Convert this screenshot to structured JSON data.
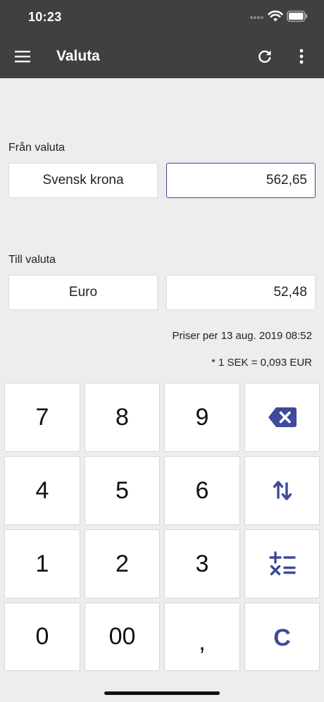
{
  "status_bar": {
    "time": "10:23"
  },
  "app_bar": {
    "title": "Valuta"
  },
  "from": {
    "label": "Från valuta",
    "currency": "Svensk krona",
    "amount": "562,65"
  },
  "to": {
    "label": "Till valuta",
    "currency": "Euro",
    "amount": "52,48"
  },
  "info": {
    "prices": "Priser per 13 aug. 2019 08:52",
    "rate": "* 1 SEK = 0,093 EUR"
  },
  "keypad": {
    "k7": "7",
    "k8": "8",
    "k9": "9",
    "k4": "4",
    "k5": "5",
    "k6": "6",
    "k1": "1",
    "k2": "2",
    "k3": "3",
    "k0": "0",
    "k00": "00",
    "comma": ",",
    "clear": "C"
  },
  "colors": {
    "bar_bg": "#404040",
    "accent": "#3f4a9a",
    "page_bg": "#ededed"
  },
  "icons": {
    "menu": "hamburger-menu-icon",
    "refresh": "refresh-icon",
    "more": "more-vertical-icon",
    "backspace": "backspace-icon",
    "swap": "swap-arrows-icon",
    "calculator": "calculator-ops-icon"
  }
}
